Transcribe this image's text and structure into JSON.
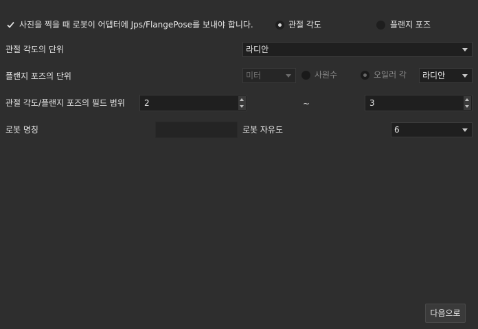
{
  "header": {
    "send_pose_checkbox_label": "사진을 찍을 때 로봇이 어댑터에 Jps/FlangePose를 보내야 합니다.",
    "send_pose_checked": true,
    "pose_type_options": [
      "관절 각도",
      "플랜지 포즈"
    ],
    "pose_type_selected": "관절 각도"
  },
  "joint_angle_unit": {
    "label": "관절 각도의 단위",
    "value": "라디안"
  },
  "flange_pose_unit": {
    "label": "플랜지 포즈의 단위",
    "length_unit_value": "미터",
    "rotation_options": [
      "사원수",
      "오일러 각"
    ],
    "rotation_selected": "오일러 각",
    "euler_unit_value": "라디안"
  },
  "field_range": {
    "label": "관절 각도/플랜지 포즈의 필드 범위",
    "min_value": "2",
    "separator": "~",
    "max_value": "3"
  },
  "robot": {
    "name_label": "로봇 명칭",
    "name_value": "",
    "dof_label": "로봇 자유도",
    "dof_value": "6"
  },
  "footer": {
    "next_button_label": "다음으로"
  },
  "colors": {
    "background": "#2e2e2e",
    "field": "#1f1f1f",
    "text": "#e6e6e6",
    "disabled_text": "#8a8a8a"
  }
}
